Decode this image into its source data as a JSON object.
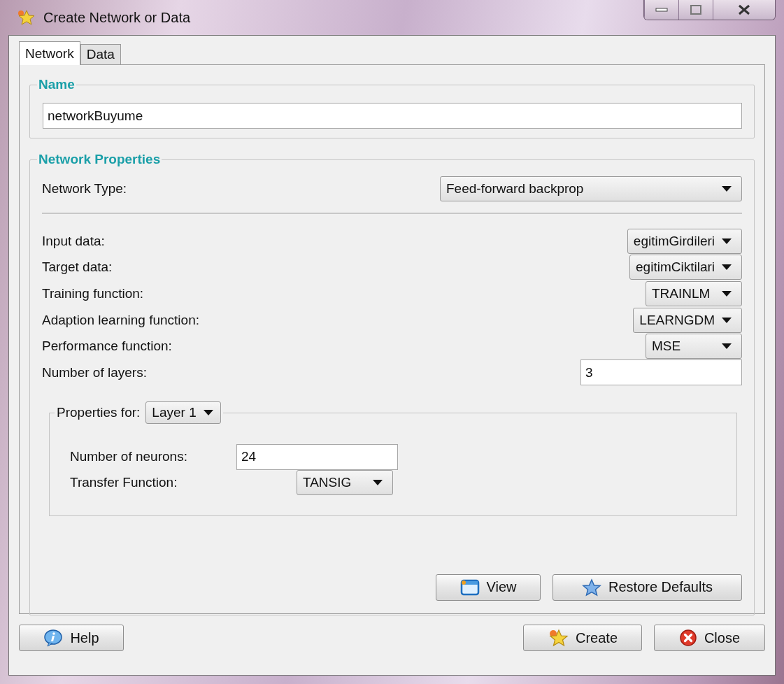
{
  "window": {
    "title": "Create Network or Data"
  },
  "tabs": [
    {
      "label": "Network",
      "selected": true
    },
    {
      "label": "Data",
      "selected": false
    }
  ],
  "name_group": {
    "title": "Name",
    "value": "networkBuyume"
  },
  "properties_group": {
    "title": "Network Properties",
    "network_type": {
      "label": "Network Type:",
      "value": "Feed-forward backprop"
    },
    "fields": [
      {
        "kind": "combo",
        "label": "Input data:",
        "value": "egitimGirdileri"
      },
      {
        "kind": "combo",
        "label": "Target data:",
        "value": "egitimCiktilari"
      },
      {
        "kind": "combo",
        "label": "Training function:",
        "value": "TRAINLM"
      },
      {
        "kind": "combo",
        "label": "Adaption learning function:",
        "value": "LEARNGDM"
      },
      {
        "kind": "combo",
        "label": "Performance function:",
        "value": "MSE"
      },
      {
        "kind": "text",
        "label": "Number of layers:",
        "value": "3"
      }
    ],
    "layer": {
      "label": "Properties for:",
      "value": "Layer 1",
      "fields": [
        {
          "kind": "text",
          "label": "Number of neurons:",
          "value": "24"
        },
        {
          "kind": "combo",
          "label": "Transfer Function:",
          "value": "TANSIG"
        }
      ]
    },
    "buttons": [
      {
        "kind": "view",
        "label": "View"
      },
      {
        "kind": "restore",
        "label": "Restore Defaults"
      }
    ]
  },
  "footer_buttons": [
    {
      "kind": "help",
      "label": "Help"
    },
    {
      "kind": "create",
      "label": "Create"
    },
    {
      "kind": "close",
      "label": "Close"
    }
  ]
}
